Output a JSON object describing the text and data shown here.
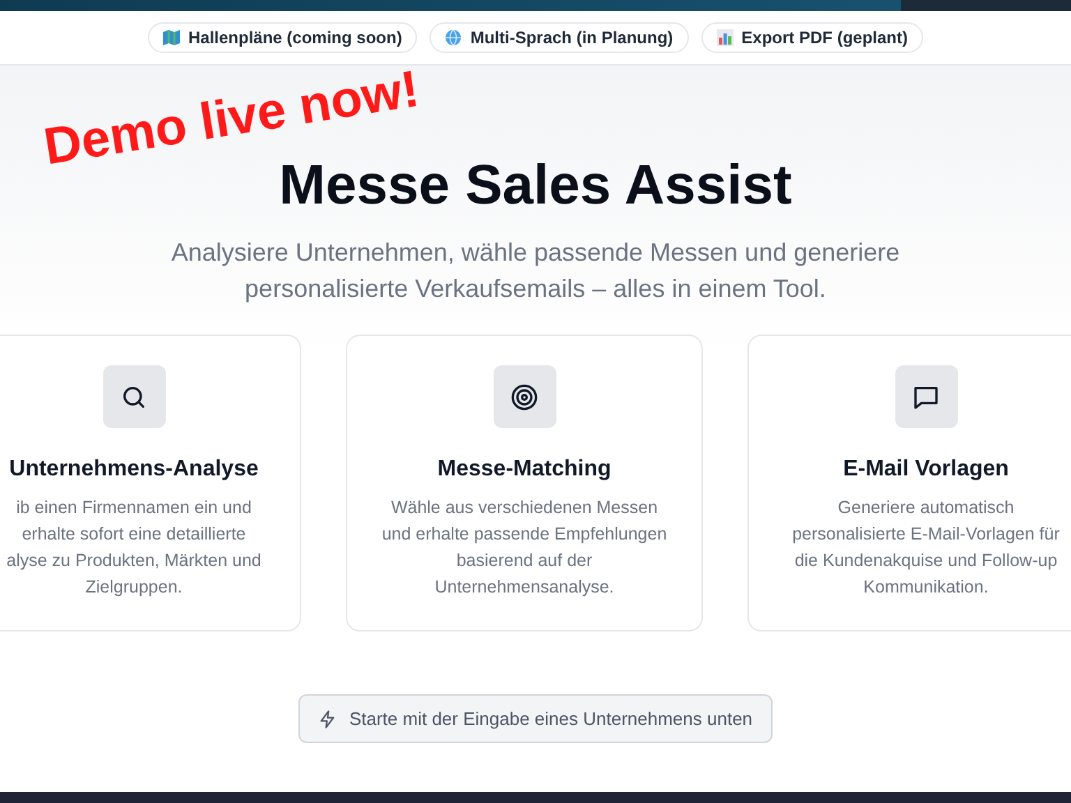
{
  "feature_chips": [
    {
      "label": "Hallenpläne (coming soon)"
    },
    {
      "label": "Multi-Sprach (in Planung)"
    },
    {
      "label": "Export PDF (geplant)"
    }
  ],
  "overlay_text": "Demo live now!",
  "hero": {
    "title": "Messe Sales Assist",
    "subtitle_lines": [
      "Analysiere Unternehmen, wähle passende Messen und generiere",
      "personalisierte Verkaufsemails – alles in einem Tool."
    ]
  },
  "features": [
    {
      "title": "Unternehmens-Analyse",
      "description_lines": [
        "ib einen Firmennamen ein und",
        "erhalte sofort eine detaillierte",
        "alyse zu Produkten, Märkten und",
        "Zielgruppen."
      ]
    },
    {
      "title": "Messe-Matching",
      "description_lines": [
        "Wähle aus verschiedenen Messen",
        "und erhalte passende Empfehlungen",
        "basierend auf der",
        "Unternehmensanalyse."
      ]
    },
    {
      "title": "E-Mail Vorlagen",
      "description_lines": [
        "Generiere automatisch",
        "personalisierte E-Mail-Vorlagen für",
        "die Kundenakquise und Follow-up",
        "Kommunikation."
      ]
    }
  ],
  "start_button": "Starte mit der Eingabe eines Unternehmens unten"
}
